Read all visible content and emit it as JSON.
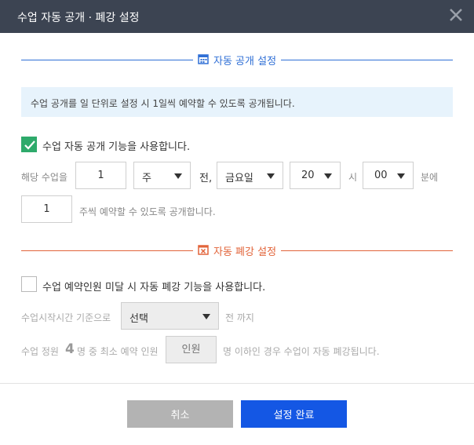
{
  "dialog": {
    "title": "수업 자동 공개 · 폐강 설정",
    "close_icon": "close-icon"
  },
  "open_section": {
    "title": "자동 공개 설정",
    "icon": "calendar-icon",
    "accent": "#2f6fd6",
    "info": "수업 공개를 일 단위로 설정 시 1일씩 예약할 수 있도록 공개됩니다.",
    "enable_label": "수업 자동 공개 기능을 사용합니다.",
    "enable_checked": true,
    "row1": {
      "prefix": "해당 수업을",
      "count_value": "1",
      "unit_value": "주",
      "before_label": "전,",
      "day_value": "금요일",
      "hour_value": "20",
      "hour_label": "시",
      "minute_value": "00",
      "minute_label": "분에"
    },
    "row2": {
      "weeks_value": "1",
      "suffix": "주씩 예약할 수 있도록 공개합니다."
    }
  },
  "cancel_section": {
    "title": "자동 폐강 설정",
    "icon": "calendar-x-icon",
    "accent": "#e2643a",
    "enable_label": "수업 예약인원 미달 시 자동 폐강 기능을 사용합니다.",
    "enable_checked": false,
    "time_label": "수업시작시간 기준으로",
    "time_select": "선택",
    "time_suffix": "전 까지",
    "capacity_prefix": "수업 정원",
    "capacity_value": "4",
    "capacity_mid": "명 중 최소 예약 인원",
    "min_placeholder": "인원",
    "capacity_suffix": "명 이하인 경우 수업이 자동 폐강됩니다."
  },
  "footer": {
    "cancel_label": "취소",
    "confirm_label": "설정 완료",
    "confirm_color": "#1457e4"
  }
}
